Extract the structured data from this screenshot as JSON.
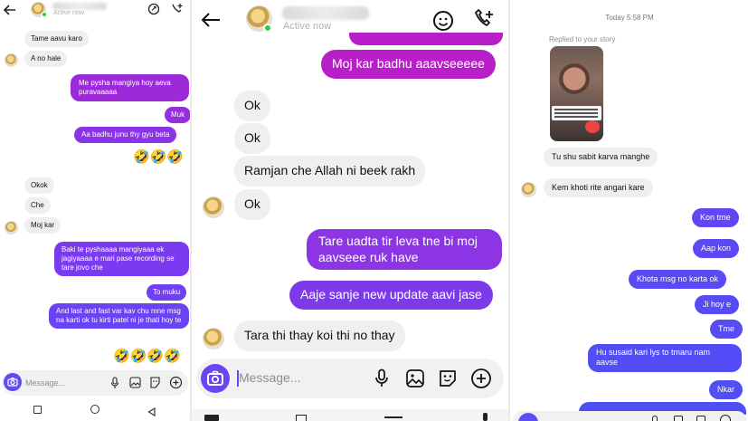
{
  "p1": {
    "header": {
      "status": "Active now"
    },
    "messages": [
      {
        "id": "m1",
        "text": "Tame aavu karo"
      },
      {
        "id": "m2",
        "text": "A no hale"
      },
      {
        "id": "m3",
        "text": "Me pysha mangiya hoy aeva puravaaaaa"
      },
      {
        "id": "m4",
        "text": "Muk"
      },
      {
        "id": "m5",
        "text": "Aa badhu junu thy gyu beta"
      },
      {
        "id": "m6",
        "text": "🤣🤣🤣"
      },
      {
        "id": "m7",
        "text": "Okok"
      },
      {
        "id": "m8",
        "text": "Che"
      },
      {
        "id": "m9",
        "text": "Moj kar"
      },
      {
        "id": "m10",
        "text": "Baki te pyshaaaa mangiyaaa ek jagiyaaaa e mari pase recording se tare jovo che"
      },
      {
        "id": "m11",
        "text": "To muku"
      },
      {
        "id": "m12",
        "text": "And last and fast var kav chu mne msg na karti ok tu kirti patel ni je thati hoy te"
      },
      {
        "id": "m13",
        "text": "🤣🤣🤣🤣"
      }
    ],
    "composer": {
      "placeholder": "Message..."
    }
  },
  "p2": {
    "header": {
      "status": "Active now"
    },
    "messages": [
      {
        "id": "n1",
        "text": "Moj kar badhu aaavseeeee"
      },
      {
        "id": "n2",
        "text": "Ok"
      },
      {
        "id": "n3",
        "text": "Ok"
      },
      {
        "id": "n4",
        "text": "Ramjan che Allah ni beek  rakh"
      },
      {
        "id": "n5",
        "text": "Ok"
      },
      {
        "id": "n6",
        "text": "Tare uadta tir leva tne bi moj aavseee ruk have"
      },
      {
        "id": "n7",
        "text": "Aaje sanje new update aavi jase"
      },
      {
        "id": "n8",
        "text": "Tara thi thay koi thi no thay"
      }
    ],
    "composer": {
      "placeholder": "Message..."
    }
  },
  "p3": {
    "timestamp": "Today 5:58 PM",
    "story_reply_label": "Replied to your story",
    "messages": [
      {
        "id": "q1",
        "text": "Tu shu sabit karva manghe"
      },
      {
        "id": "q2",
        "text": "Kem khoti rite angari kare"
      },
      {
        "id": "q3",
        "text": "Kon tme"
      },
      {
        "id": "q4",
        "text": "Aap kon"
      },
      {
        "id": "q5",
        "text": "Khota msg no karta ok"
      },
      {
        "id": "q6",
        "text": "Ji hoy e"
      },
      {
        "id": "q7",
        "text": "Tme"
      },
      {
        "id": "q8",
        "text": "Hu susaid kari lys to tmaru nam aavse"
      },
      {
        "id": "q9",
        "text": "Nkar"
      }
    ]
  },
  "colors": {
    "accent": "#7b2ff7",
    "accent2": "#a126d4",
    "magenta": "#b81fc9",
    "incoming": "#efefef"
  },
  "icons": [
    "back-arrow-icon",
    "sticker-icon",
    "video-call-icon",
    "camera-icon",
    "mic-icon",
    "gallery-icon",
    "sticker-icon",
    "add-icon",
    "nav-back-icon",
    "home-icon",
    "recents-icon"
  ]
}
